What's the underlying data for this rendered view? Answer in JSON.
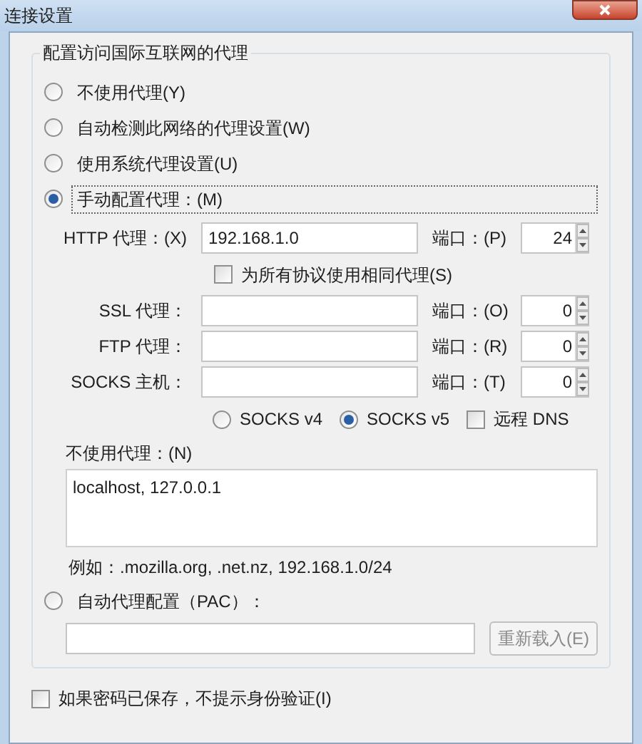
{
  "window": {
    "title": "连接设置"
  },
  "group": {
    "title": "配置访问国际互联网的代理"
  },
  "proxy_modes": [
    {
      "label": "不使用代理(Y)",
      "selected": false
    },
    {
      "label": "自动检测此网络的代理设置(W)",
      "selected": false
    },
    {
      "label": "使用系统代理设置(U)",
      "selected": false
    },
    {
      "label": "手动配置代理：(M)",
      "selected": true
    }
  ],
  "http": {
    "label": "HTTP 代理：(X)",
    "value": "192.168.1.0",
    "port_label": "端口：(P)",
    "port": "24"
  },
  "same_for_all": {
    "label": "为所有协议使用相同代理(S)",
    "checked": false
  },
  "proxies": [
    {
      "label": "SSL 代理：",
      "port_label": "端口：(O)",
      "port": "0"
    },
    {
      "label": "FTP 代理：",
      "port_label": "端口：(R)",
      "port": "0"
    },
    {
      "label": "SOCKS 主机：",
      "port_label": "端口：(T)",
      "port": "0"
    }
  ],
  "socks_versions": [
    {
      "label": "SOCKS v4",
      "selected": false
    },
    {
      "label": "SOCKS v5",
      "selected": true
    }
  ],
  "remote_dns": {
    "label": "远程 DNS",
    "checked": false
  },
  "no_proxy": {
    "label": "不使用代理：(N)",
    "value": "localhost, 127.0.0.1",
    "example": "例如：.mozilla.org, .net.nz, 192.168.1.0/24"
  },
  "pac": {
    "label": "自动代理配置（PAC）：",
    "selected": false,
    "button": {
      "label": "重新载入(E)",
      "disabled": true
    }
  },
  "no_auth_prompt": {
    "label": "如果密码已保存，不提示身份验证(I)",
    "checked": false
  }
}
